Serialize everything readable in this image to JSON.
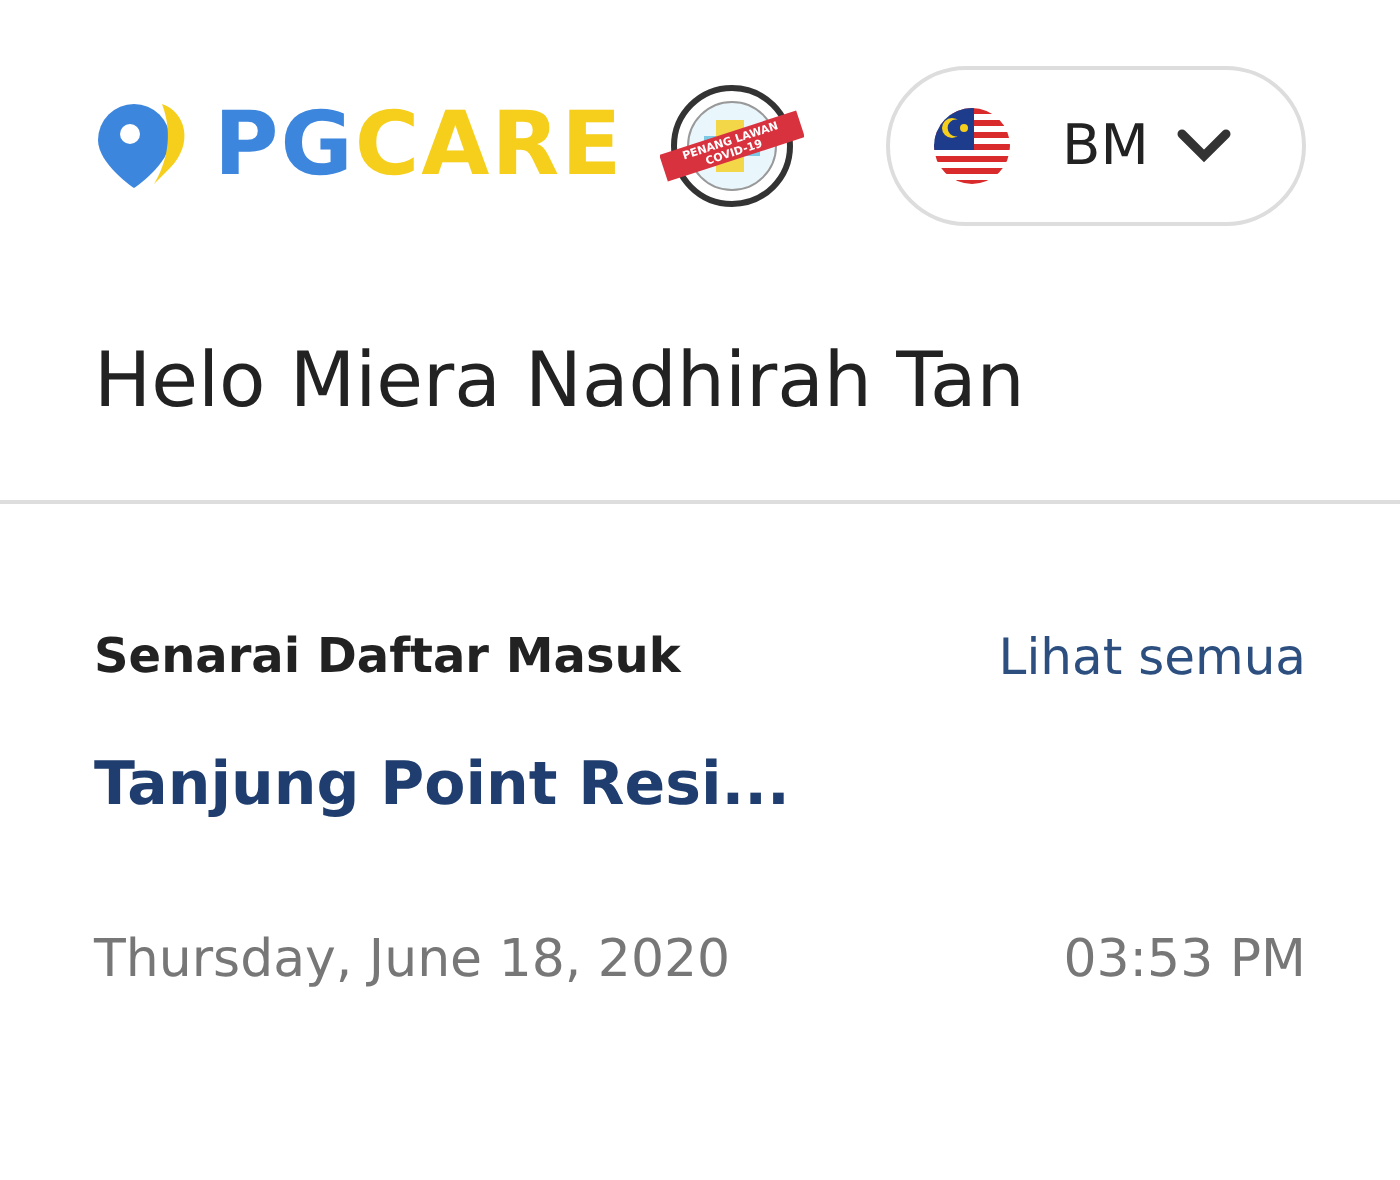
{
  "logo": {
    "parts": [
      "PG",
      "CARE"
    ],
    "badge_text": "PENANG LAWAN COVID-19"
  },
  "language": {
    "label": "BM"
  },
  "greeting": "Helo Miera Nadhirah Tan",
  "section": {
    "title": "Senarai Daftar Masuk",
    "link": "Lihat semua"
  },
  "entries": [
    {
      "place": "Tanjung Point Resi...",
      "date": "Thursday, June 18, 2020",
      "time": "03:53 PM"
    }
  ]
}
